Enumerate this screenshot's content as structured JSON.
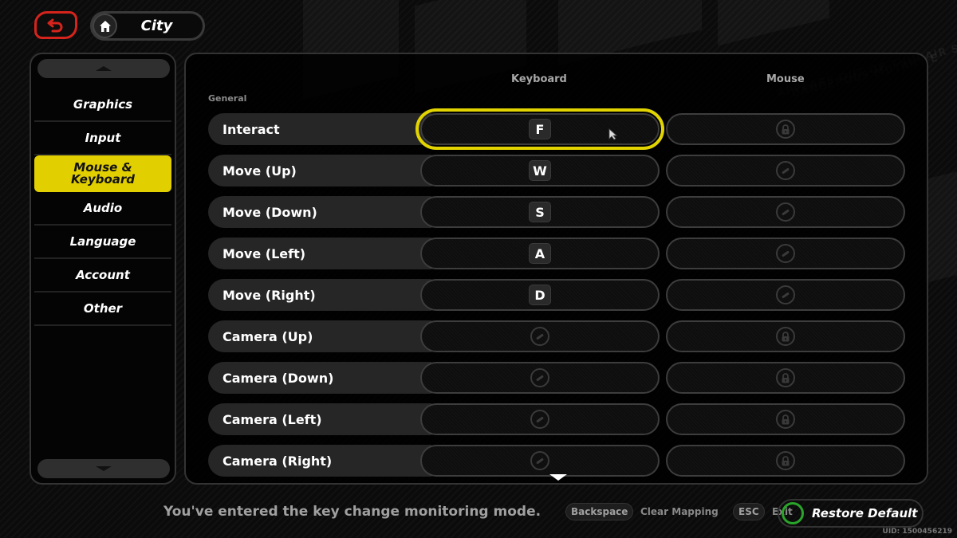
{
  "top_bar": {
    "back_icon": "undo-arrow-icon",
    "home_icon": "house-icon",
    "location": "City"
  },
  "sidebar": {
    "scroll_up_icon": "triangle-up-icon",
    "scroll_down_icon": "triangle-down-icon",
    "items": [
      {
        "label": "Graphics",
        "active": false
      },
      {
        "label": "Input",
        "active": false
      },
      {
        "label": "Mouse & Keyboard",
        "active": true
      },
      {
        "label": "Audio",
        "active": false
      },
      {
        "label": "Language",
        "active": false
      },
      {
        "label": "Account",
        "active": false
      },
      {
        "label": "Other",
        "active": false
      }
    ]
  },
  "main": {
    "columns": {
      "keyboard": "Keyboard",
      "mouse": "Mouse"
    },
    "section": "General",
    "selected_row": 0,
    "rows": [
      {
        "action": "Interact",
        "keyboard": "F",
        "mouse": "lock-icon"
      },
      {
        "action": "Move (Up)",
        "keyboard": "W",
        "mouse": "unbound-icon"
      },
      {
        "action": "Move (Down)",
        "keyboard": "S",
        "mouse": "unbound-icon"
      },
      {
        "action": "Move (Left)",
        "keyboard": "A",
        "mouse": "unbound-icon"
      },
      {
        "action": "Move (Right)",
        "keyboard": "D",
        "mouse": "unbound-icon"
      },
      {
        "action": "Camera (Up)",
        "keyboard": "unbound-icon",
        "mouse": "lock-icon"
      },
      {
        "action": "Camera (Down)",
        "keyboard": "unbound-icon",
        "mouse": "lock-icon"
      },
      {
        "action": "Camera (Left)",
        "keyboard": "unbound-icon",
        "mouse": "lock-icon"
      },
      {
        "action": "Camera (Right)",
        "keyboard": "unbound-icon",
        "mouse": "lock-icon"
      }
    ]
  },
  "bottom_bar": {
    "status": "You've entered the key change monitoring mode.",
    "hints": [
      {
        "key": "Backspace",
        "label": "Clear Mapping"
      },
      {
        "key": "ESC",
        "label": "Exit"
      }
    ],
    "restore_default": "Restore Default",
    "uid": "UID: 1500456219"
  },
  "colors": {
    "accent_yellow": "#e2cf00",
    "back_red": "#d6241c",
    "confirm_green": "#2aa42a",
    "background": "#0b0b0b"
  }
}
